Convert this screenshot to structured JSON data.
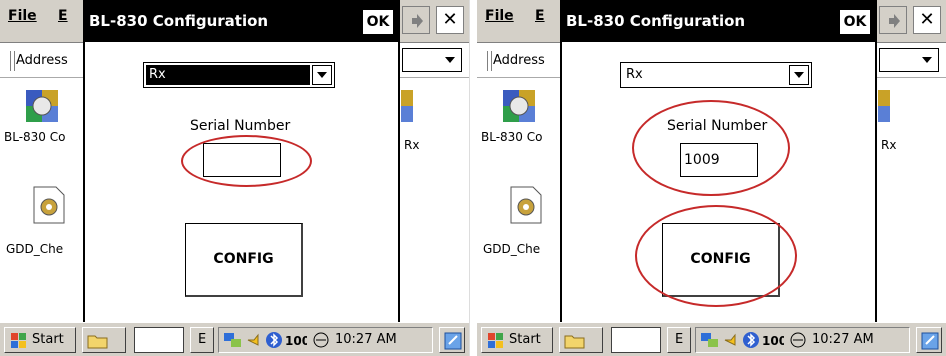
{
  "screens": [
    {
      "menu": {
        "file": "File",
        "edit": "E"
      },
      "address_label": "Address",
      "desktop_icons": [
        {
          "label": "BL-830 Co",
          "icon": "application-icon"
        },
        {
          "label": "GDD_Che",
          "icon": "settings-document-icon"
        }
      ],
      "side_text": "Rx",
      "dialog": {
        "title": "BL-830 Configuration",
        "ok_label": "OK",
        "combo_value": "Rx",
        "serial_label": "Serial Number",
        "serial_value": "",
        "config_label": "CONFIG"
      },
      "taskbar": {
        "start_label": "Start",
        "task_label": "E",
        "clock": "10:27 AM"
      }
    },
    {
      "menu": {
        "file": "File",
        "edit": "E"
      },
      "address_label": "Address",
      "desktop_icons": [
        {
          "label": "BL-830 Co",
          "icon": "application-icon"
        },
        {
          "label": "GDD_Che",
          "icon": "settings-document-icon"
        }
      ],
      "side_text": "Rx",
      "dialog": {
        "title": "BL-830 Configuration",
        "ok_label": "OK",
        "combo_value": "Rx",
        "serial_label": "Serial Number",
        "serial_value": "1009",
        "config_label": "CONFIG"
      },
      "taskbar": {
        "start_label": "Start",
        "task_label": "E",
        "clock": "10:27 AM"
      }
    }
  ],
  "colors": {
    "callout": "#c62a2a",
    "titlebar": "#000000",
    "taskbar": "#d4d0c8"
  },
  "callouts": [
    "serial-input-callout",
    "serial-group-callout",
    "config-button-callout"
  ]
}
